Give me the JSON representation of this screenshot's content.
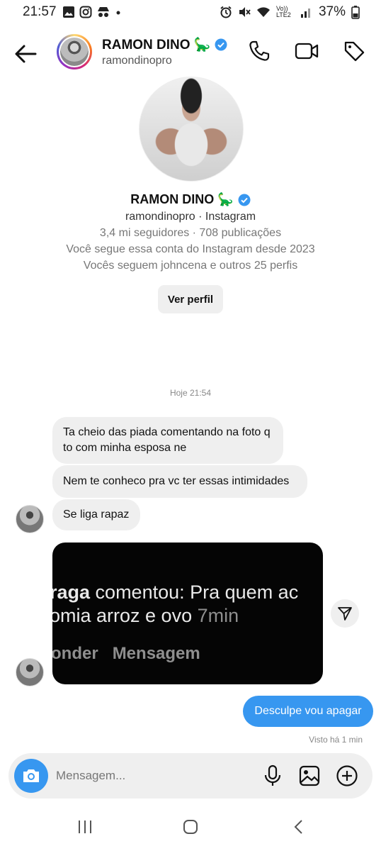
{
  "status_bar": {
    "time": "21:57",
    "network": "Vo)) LTE2",
    "battery": "37%",
    "left_icons": [
      "gallery-icon",
      "instagram-icon",
      "spy-icon",
      "dot-icon"
    ],
    "right_icons": [
      "alarm-icon",
      "mute-icon",
      "wifi-icon",
      "signal-icon",
      "battery-icon"
    ]
  },
  "header": {
    "name": "RAMON DINO 🦕",
    "username": "ramondinopro",
    "icons": [
      "back-arrow-icon",
      "phone-icon",
      "video-icon",
      "tag-icon"
    ]
  },
  "profile": {
    "name": "RAMON DINO 🦕",
    "source": "ramondinopro · Instagram",
    "stats": "3,4 mi seguidores · 708 publicações",
    "follow_since": "Você segue essa conta do Instagram desde 2023",
    "mutual": "Vocês seguem johncena e outros 25 perfis",
    "view_button": "Ver perfil"
  },
  "chat": {
    "timestamp": "Hoje 21:54",
    "incoming": [
      "Ta cheio das piada comentando na foto q to com minha esposa ne",
      "Nem te conheco pra vc ter essas intimidades",
      "Se liga rapaz"
    ],
    "screenshot": {
      "line1_bold": "raga",
      "line1_rest": " comentou: Pra quem ac",
      "line2": "omia arroz e ovo ",
      "line2_time": "7min",
      "line3_a": "onder",
      "line3_b": "Mensagem"
    },
    "outgoing": "Desculpe vou apagar",
    "seen": "Visto há 1 min"
  },
  "composer": {
    "placeholder": "Mensagem...",
    "icons": [
      "camera-icon",
      "microphone-icon",
      "gallery-icon",
      "add-icon"
    ]
  },
  "colors": {
    "accent": "#3797f0",
    "bubble_gray": "#efefef",
    "verified": "#3797f0"
  }
}
